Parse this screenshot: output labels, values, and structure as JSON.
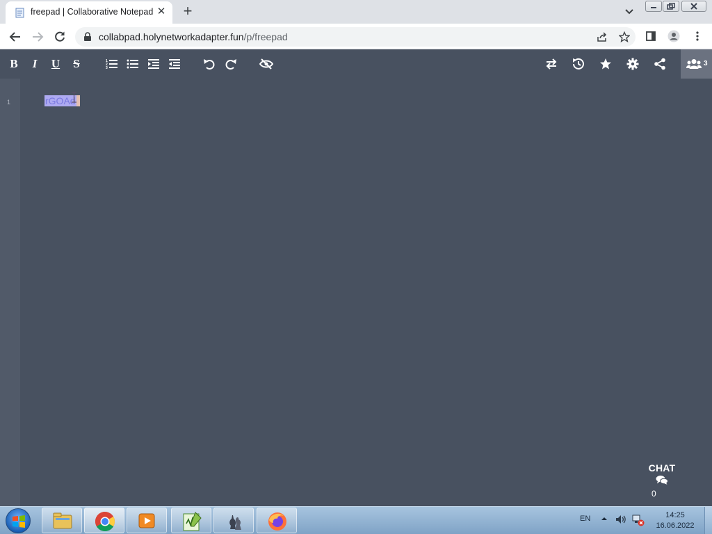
{
  "browser": {
    "tab_title": "freepad | Collaborative Notepad",
    "url_host": "collabpad.holynetworkadapter.fun",
    "url_path": "/p/freepad"
  },
  "pad": {
    "toolbar_left": [
      {
        "name": "bold-button",
        "glyph": "B"
      },
      {
        "name": "italic-button",
        "glyph": "I"
      },
      {
        "name": "underline-button",
        "glyph": "U"
      },
      {
        "name": "strikethrough-button",
        "glyph": "S"
      }
    ],
    "users_count": "3",
    "line_number": "1",
    "selected_text": "rGOAd",
    "chat_label": "CHAT",
    "chat_count": "0"
  },
  "taskbar": {
    "language": "EN",
    "time": "14:25",
    "date": "16.06.2022"
  },
  "colors": {
    "editor_bg": "#485160",
    "selection": "#aeaaf2",
    "chrome_tabstrip": "#dee1e6"
  }
}
